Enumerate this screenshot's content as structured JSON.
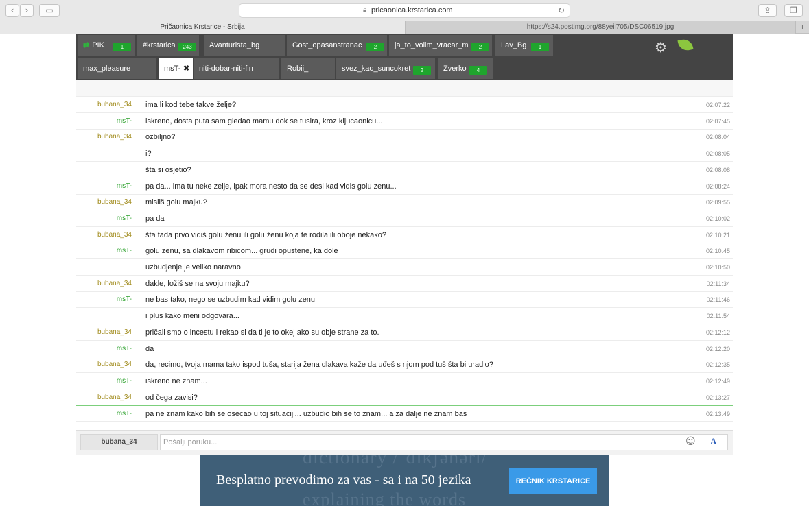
{
  "browser": {
    "url": "pricaonica.krstarica.com",
    "tabs": [
      {
        "title": "Pričaonica Krstarice - Srbija"
      },
      {
        "title": "https://s24.postimg.org/88yeil705/DSC06519.jpg"
      }
    ],
    "new_tab": "+"
  },
  "rooms_row1": [
    {
      "name": "PIK",
      "count": "1"
    },
    {
      "name": "#krstarica",
      "count": "243"
    },
    {
      "name": "Avanturista_bg",
      "count": ""
    },
    {
      "name": "Gost_opasanstranac",
      "count": "2"
    },
    {
      "name": "ja_to_volim_vracar_m",
      "count": "2"
    },
    {
      "name": "Lav_Bg",
      "count": "1"
    }
  ],
  "rooms_row2": [
    {
      "name": "max_pleasure",
      "count": ""
    },
    {
      "name": "msT-",
      "count": "",
      "active": true
    },
    {
      "name": "niti-dobar-niti-fin",
      "count": ""
    },
    {
      "name": "Robii_",
      "count": ""
    },
    {
      "name": "svez_kao_suncokret",
      "count": "2"
    },
    {
      "name": "Zverko",
      "count": "4"
    }
  ],
  "messages": [
    {
      "nick": "bubana_34",
      "text": "ima li kod tebe takve želje?",
      "time": "02:07:22"
    },
    {
      "nick": "msT-",
      "text": "iskreno, dosta puta sam gledao mamu dok se tusira, kroz kljucaonicu...",
      "time": "02:07:45"
    },
    {
      "nick": "bubana_34",
      "text": "ozbiljno?",
      "time": "02:08:04"
    },
    {
      "nick": "",
      "text": "i?",
      "time": "02:08:05"
    },
    {
      "nick": "",
      "text": "šta si osjetio?",
      "time": "02:08:08"
    },
    {
      "nick": "msT-",
      "text": "pa da... ima tu neke zelje, ipak mora nesto da se desi kad vidis golu zenu...",
      "time": "02:08:24"
    },
    {
      "nick": "bubana_34",
      "text": "misliš golu majku?",
      "time": "02:09:55"
    },
    {
      "nick": "msT-",
      "text": "pa da",
      "time": "02:10:02"
    },
    {
      "nick": "bubana_34",
      "text": "šta tada prvo vidiš golu ženu ili golu ženu koja te rodila ili oboje nekako?",
      "time": "02:10:21"
    },
    {
      "nick": "msT-",
      "text": "golu zenu, sa dlakavom ribicom... grudi opustene, ka dole",
      "time": "02:10:45"
    },
    {
      "nick": "",
      "text": "uzbudjenje je veliko naravno",
      "time": "02:10:50"
    },
    {
      "nick": "bubana_34",
      "text": "dakle, ložiš se na svoju majku?",
      "time": "02:11:34"
    },
    {
      "nick": "msT-",
      "text": "ne bas tako, nego se uzbudim kad vidim golu zenu",
      "time": "02:11:46"
    },
    {
      "nick": "",
      "text": "i plus kako meni odgovara...",
      "time": "02:11:54"
    },
    {
      "nick": "bubana_34",
      "text": "pričali smo o incestu i rekao si da ti je to okej ako su obje strane za to.",
      "time": "02:12:12"
    },
    {
      "nick": "msT-",
      "text": "da",
      "time": "02:12:20"
    },
    {
      "nick": "bubana_34",
      "text": "da, recimo, tvoja mama tako ispod tuša, starija žena dlakava kaže da uđeš s njom pod tuš šta bi uradio?",
      "time": "02:12:35"
    },
    {
      "nick": "msT-",
      "text": "iskreno ne znam...",
      "time": "02:12:49"
    },
    {
      "nick": "bubana_34",
      "text": "od čega zavisi?",
      "time": "02:13:27"
    },
    {
      "nick": "msT-",
      "text": "pa ne znam kako bih se osecao u toj situaciji... uzbudio bih se to znam... a za dalje ne znam bas",
      "time": "02:13:49"
    }
  ],
  "input": {
    "my_nick": "bubana_34",
    "placeholder": "Pošalji poruku...",
    "font_button": "A"
  },
  "ad": {
    "slogan": "Besplatno prevodimo za vas - sa i na 50 jezika",
    "cta": "REČNIK KRSTARICE",
    "background_line1": "dictionary /ˈdɪkʃənərɪ/",
    "background_line2": "explaining the words"
  },
  "colors": {
    "room_bar": "#444444",
    "badge": "#1fa52d",
    "nick_bubana": "#a08a1a",
    "nick_mst": "#2aa02a",
    "ad_bg": "#3f5f78",
    "cta_bg": "#3a9ae8"
  },
  "icons": [
    "back-icon",
    "forward-icon",
    "sidebar-icon",
    "lock-icon",
    "reload-icon",
    "share-icon",
    "tabs-icon",
    "pik-arrows-icon",
    "settings-gears-icon",
    "leaf-icon",
    "close-icon",
    "smiley-icon"
  ]
}
